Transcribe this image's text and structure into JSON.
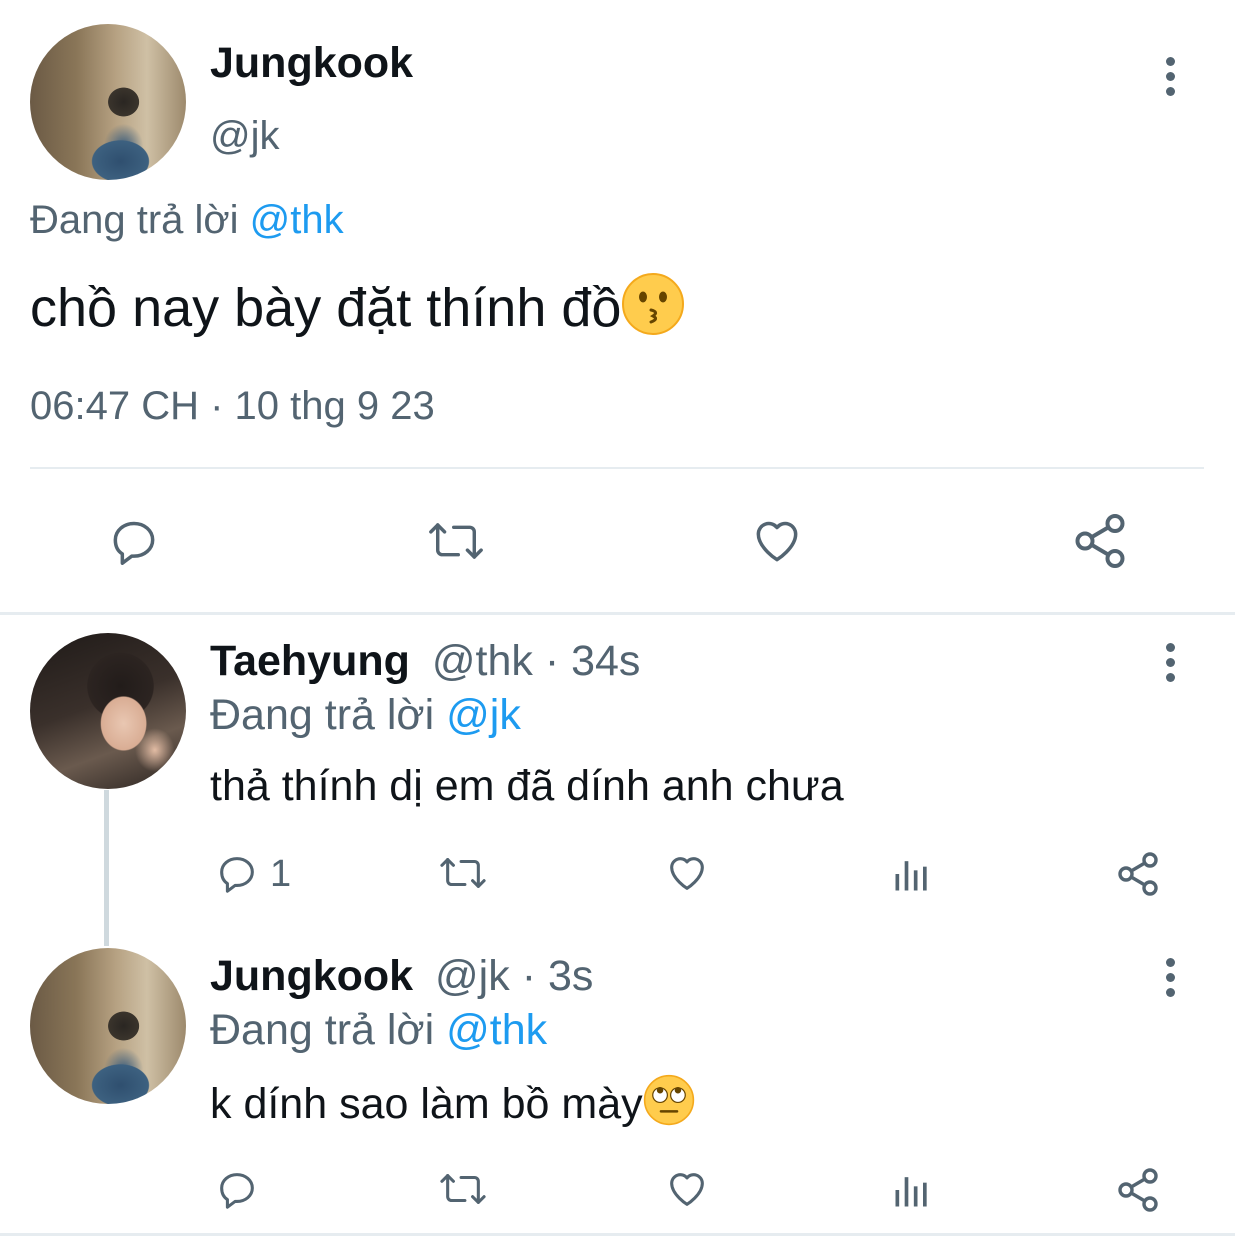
{
  "main_tweet": {
    "display_name": "Jungkook",
    "handle": "@jk",
    "replying_prefix": "Đang trả lời",
    "replying_to": "@thk",
    "text": "chồ nay bày đặt thính đồ",
    "emoji": "kissing-face",
    "timestamp": "06:47 CH · 10 thg 9 23"
  },
  "replies": [
    {
      "display_name": "Taehyung",
      "handle": "@thk",
      "time": "· 34s",
      "replying_prefix": "Đang trả lời",
      "replying_to": "@jk",
      "text": "thả thính dị em đã dính anh chưa",
      "reply_count": "1"
    },
    {
      "display_name": "Jungkook",
      "handle": "@jk",
      "time": "· 3s",
      "replying_prefix": "Đang trả lời",
      "replying_to": "@thk",
      "text": "k dính sao làm bồ mày",
      "emoji": "face-with-rolling-eyes",
      "reply_count": ""
    }
  ],
  "colors": {
    "link": "#1d9bf0",
    "muted": "#536471",
    "text": "#0f1419",
    "divider": "#e6ecf0"
  },
  "icons": [
    "more-icon",
    "reply-icon",
    "retweet-icon",
    "like-icon",
    "views-icon",
    "share-icon"
  ]
}
